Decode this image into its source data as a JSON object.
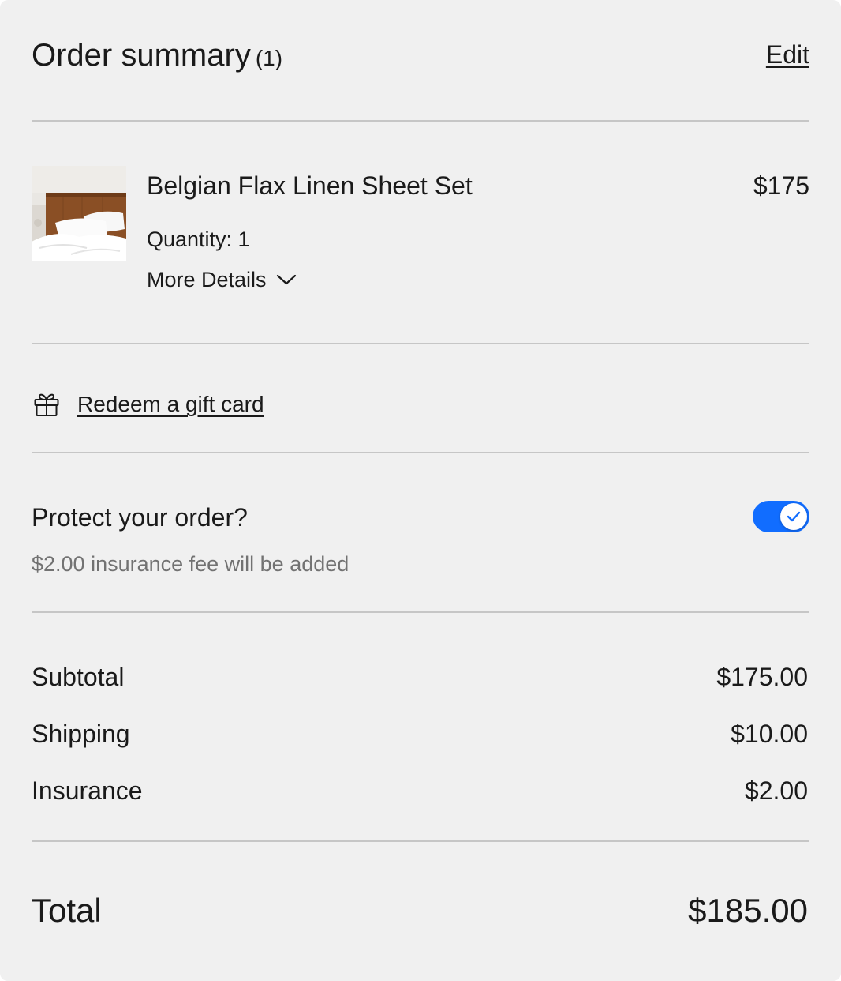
{
  "header": {
    "title": "Order summary",
    "count": "(1)",
    "edit_label": "Edit"
  },
  "item": {
    "name": "Belgian Flax Linen Sheet Set",
    "price": "$175",
    "quantity": "Quantity: 1",
    "more_details_label": "More Details",
    "thumbnail_icon": "product-photo-bed-linen"
  },
  "gift_card": {
    "icon": "gift-icon",
    "label": "Redeem a gift card"
  },
  "protection": {
    "label": "Protect your order?",
    "description": "$2.00 insurance fee will be added",
    "enabled": true,
    "toggle_color": "#116dff"
  },
  "totals": {
    "rows": [
      {
        "label": "Subtotal",
        "value": "$175.00"
      },
      {
        "label": "Shipping",
        "value": "$10.00"
      },
      {
        "label": "Insurance",
        "value": "$2.00"
      }
    ],
    "total_label": "Total",
    "total_value": "$185.00"
  },
  "colors": {
    "background": "#f0f0f0",
    "text": "#1a1a1a",
    "muted_text": "#727272",
    "divider": "#c6c6c6",
    "accent": "#116dff"
  }
}
